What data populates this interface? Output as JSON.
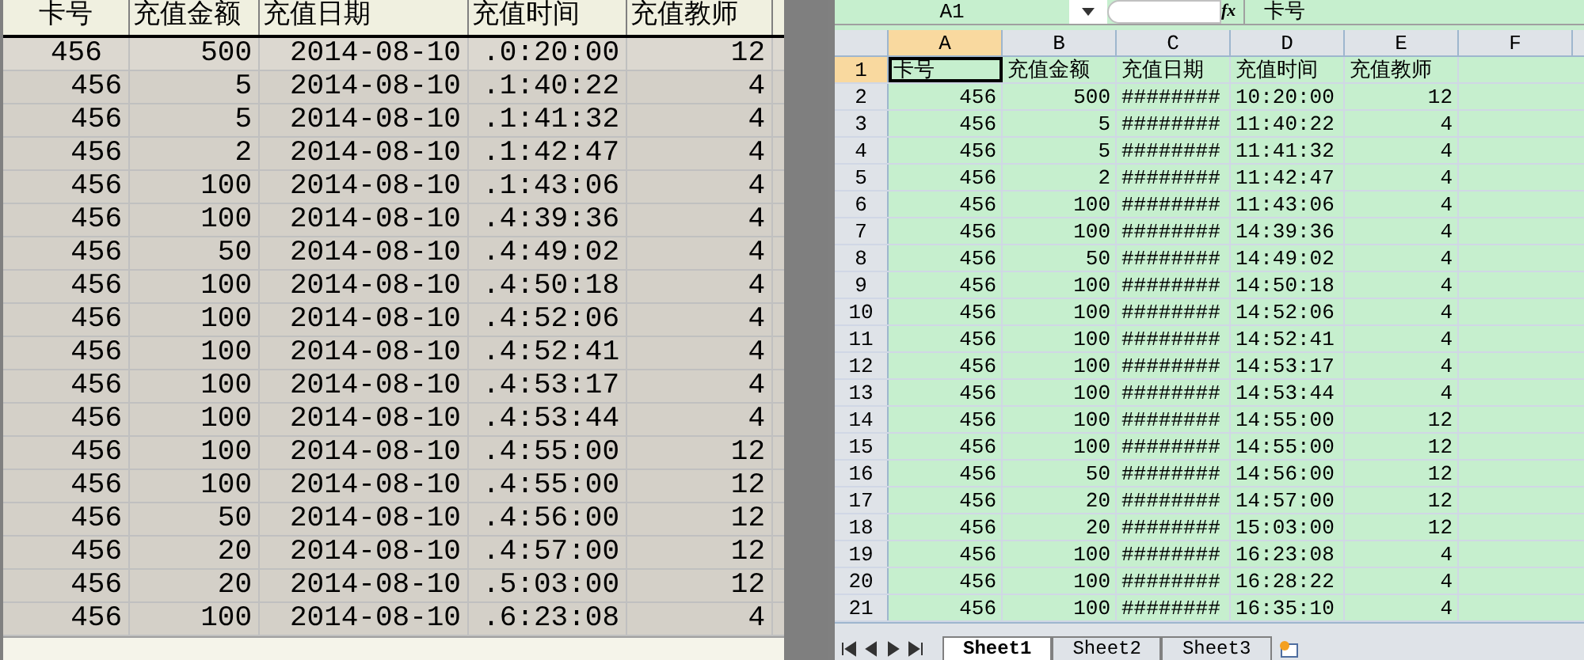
{
  "grid": {
    "columns": [
      "卡号",
      "充值金额",
      "充值日期",
      "充值时间",
      "充值教师"
    ],
    "rows": [
      {
        "cells": [
          "456",
          "500",
          "2014-08-10",
          ".0:20:00",
          "12"
        ],
        "selected": true
      },
      {
        "cells": [
          "456",
          "5",
          "2014-08-10",
          ".1:40:22",
          "4"
        ],
        "selected": false
      },
      {
        "cells": [
          "456",
          "5",
          "2014-08-10",
          ".1:41:32",
          "4"
        ],
        "selected": false
      },
      {
        "cells": [
          "456",
          "2",
          "2014-08-10",
          ".1:42:47",
          "4"
        ],
        "selected": false
      },
      {
        "cells": [
          "456",
          "100",
          "2014-08-10",
          ".1:43:06",
          "4"
        ],
        "selected": false
      },
      {
        "cells": [
          "456",
          "100",
          "2014-08-10",
          ".4:39:36",
          "4"
        ],
        "selected": false
      },
      {
        "cells": [
          "456",
          "50",
          "2014-08-10",
          ".4:49:02",
          "4"
        ],
        "selected": false
      },
      {
        "cells": [
          "456",
          "100",
          "2014-08-10",
          ".4:50:18",
          "4"
        ],
        "selected": false
      },
      {
        "cells": [
          "456",
          "100",
          "2014-08-10",
          ".4:52:06",
          "4"
        ],
        "selected": false
      },
      {
        "cells": [
          "456",
          "100",
          "2014-08-10",
          ".4:52:41",
          "4"
        ],
        "selected": false
      },
      {
        "cells": [
          "456",
          "100",
          "2014-08-10",
          ".4:53:17",
          "4"
        ],
        "selected": false
      },
      {
        "cells": [
          "456",
          "100",
          "2014-08-10",
          ".4:53:44",
          "4"
        ],
        "selected": false
      },
      {
        "cells": [
          "456",
          "100",
          "2014-08-10",
          ".4:55:00",
          "12"
        ],
        "selected": false
      },
      {
        "cells": [
          "456",
          "100",
          "2014-08-10",
          ".4:55:00",
          "12"
        ],
        "selected": false
      },
      {
        "cells": [
          "456",
          "50",
          "2014-08-10",
          ".4:56:00",
          "12"
        ],
        "selected": false
      },
      {
        "cells": [
          "456",
          "20",
          "2014-08-10",
          ".4:57:00",
          "12"
        ],
        "selected": false
      },
      {
        "cells": [
          "456",
          "20",
          "2014-08-10",
          ".5:03:00",
          "12"
        ],
        "selected": false
      },
      {
        "cells": [
          "456",
          "100",
          "2014-08-10",
          ".6:23:08",
          "4"
        ],
        "selected": false
      }
    ]
  },
  "spreadsheet": {
    "name_box": "A1",
    "formula_label": "fx",
    "formula": "卡号",
    "column_headers": [
      "A",
      "B",
      "C",
      "D",
      "E",
      "F"
    ],
    "rows": [
      {
        "number": "1",
        "cells": [
          "卡号",
          "充值金额",
          "充值日期",
          "充值时间",
          "充值教师"
        ]
      },
      {
        "number": "2",
        "cells": [
          "456",
          "500",
          "########",
          "10:20:00",
          "12"
        ]
      },
      {
        "number": "3",
        "cells": [
          "456",
          "5",
          "########",
          "11:40:22",
          "4"
        ]
      },
      {
        "number": "4",
        "cells": [
          "456",
          "5",
          "########",
          "11:41:32",
          "4"
        ]
      },
      {
        "number": "5",
        "cells": [
          "456",
          "2",
          "########",
          "11:42:47",
          "4"
        ]
      },
      {
        "number": "6",
        "cells": [
          "456",
          "100",
          "########",
          "11:43:06",
          "4"
        ]
      },
      {
        "number": "7",
        "cells": [
          "456",
          "100",
          "########",
          "14:39:36",
          "4"
        ]
      },
      {
        "number": "8",
        "cells": [
          "456",
          "50",
          "########",
          "14:49:02",
          "4"
        ]
      },
      {
        "number": "9",
        "cells": [
          "456",
          "100",
          "########",
          "14:50:18",
          "4"
        ]
      },
      {
        "number": "10",
        "cells": [
          "456",
          "100",
          "########",
          "14:52:06",
          "4"
        ]
      },
      {
        "number": "11",
        "cells": [
          "456",
          "100",
          "########",
          "14:52:41",
          "4"
        ]
      },
      {
        "number": "12",
        "cells": [
          "456",
          "100",
          "########",
          "14:53:17",
          "4"
        ]
      },
      {
        "number": "13",
        "cells": [
          "456",
          "100",
          "########",
          "14:53:44",
          "4"
        ]
      },
      {
        "number": "14",
        "cells": [
          "456",
          "100",
          "########",
          "14:55:00",
          "12"
        ]
      },
      {
        "number": "15",
        "cells": [
          "456",
          "100",
          "########",
          "14:55:00",
          "12"
        ]
      },
      {
        "number": "16",
        "cells": [
          "456",
          "50",
          "########",
          "14:56:00",
          "12"
        ]
      },
      {
        "number": "17",
        "cells": [
          "456",
          "20",
          "########",
          "14:57:00",
          "12"
        ]
      },
      {
        "number": "18",
        "cells": [
          "456",
          "20",
          "########",
          "15:03:00",
          "12"
        ]
      },
      {
        "number": "19",
        "cells": [
          "456",
          "100",
          "########",
          "16:23:08",
          "4"
        ]
      },
      {
        "number": "20",
        "cells": [
          "456",
          "100",
          "########",
          "16:28:22",
          "4"
        ]
      },
      {
        "number": "21",
        "cells": [
          "456",
          "100",
          "########",
          "16:35:10",
          "4"
        ]
      }
    ],
    "sheet_tabs": [
      {
        "label": "Sheet1",
        "selected": true
      },
      {
        "label": "Sheet2",
        "selected": false
      },
      {
        "label": "Sheet3",
        "selected": false
      }
    ]
  }
}
